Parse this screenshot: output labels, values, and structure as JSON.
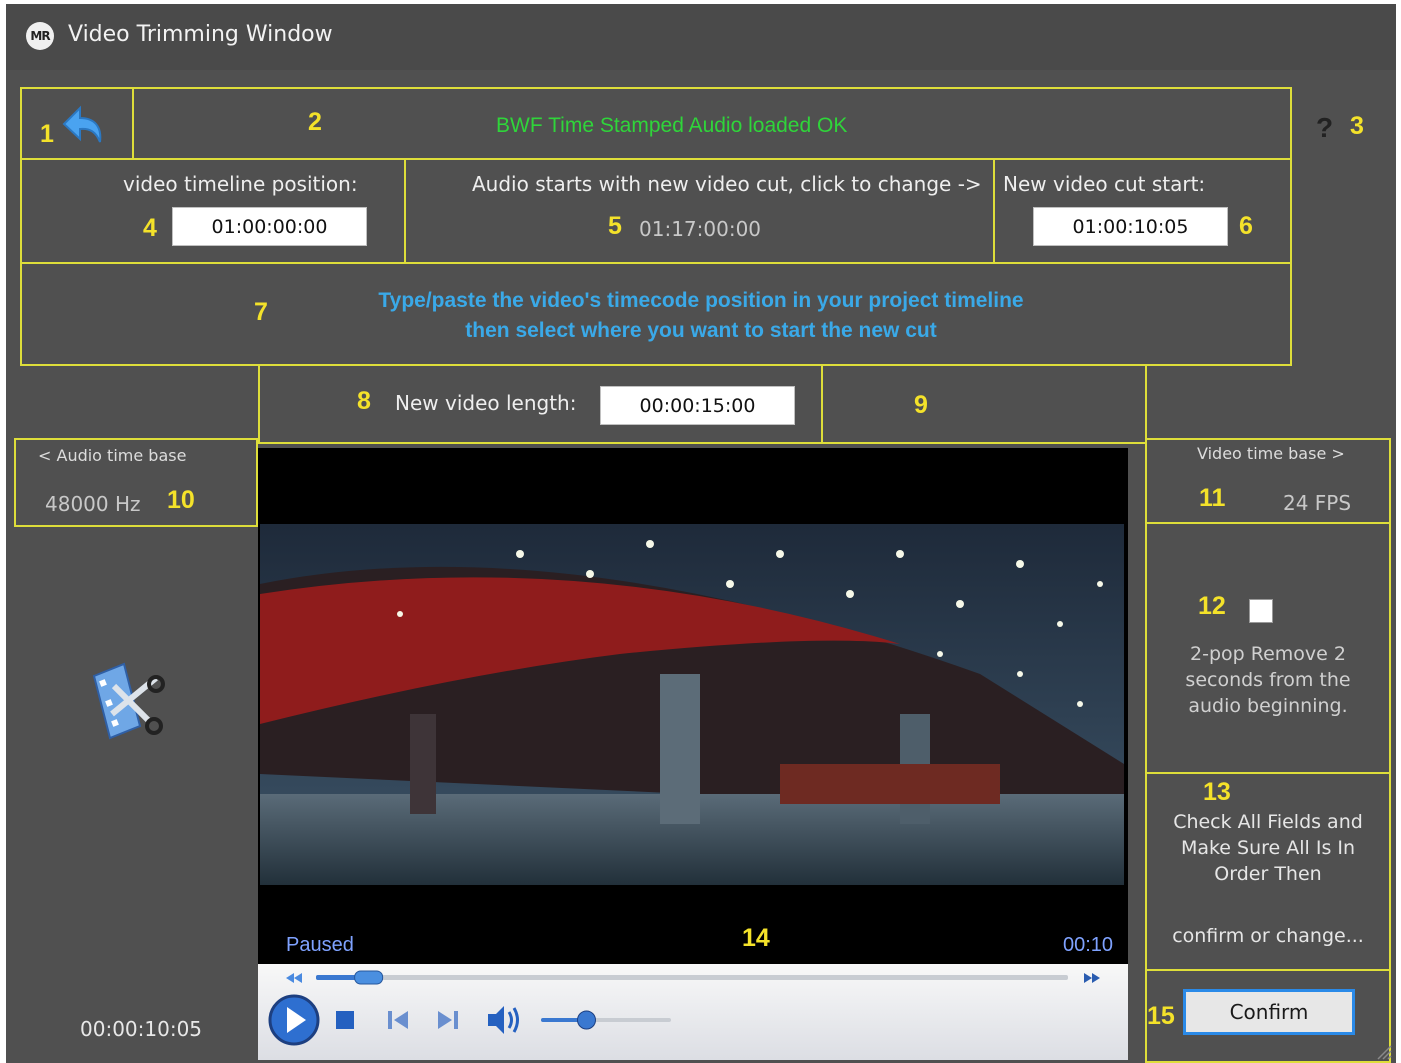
{
  "window": {
    "title": "Video Trimming Window",
    "logo_text": "MR"
  },
  "markers": {
    "m1": "1",
    "m2": "2",
    "m3": "3",
    "m4": "4",
    "m5": "5",
    "m6": "6",
    "m7": "7",
    "m8": "8",
    "m9": "9",
    "m10": "10",
    "m11": "11",
    "m12": "12",
    "m13": "13",
    "m14": "14",
    "m15": "15"
  },
  "status": {
    "message": "BWF Time Stamped Audio loaded OK",
    "help": "?"
  },
  "timeline": {
    "label": "video timeline position:",
    "value": "01:00:00:00"
  },
  "audio_start": {
    "label": "Audio starts with new video cut, click to change ->",
    "value": "01:17:00:00"
  },
  "cut_start": {
    "label": "New video cut start:",
    "value": "01:00:10:05"
  },
  "hint": {
    "line1": "Type/paste the video's timecode position in your project timeline",
    "line2": "then select where you want to start the new cut"
  },
  "length": {
    "label": "New video length:",
    "value": "00:00:15:00"
  },
  "audio_base": {
    "label": "< Audio time base",
    "value": "48000 Hz"
  },
  "video_base": {
    "label": "Video time base >",
    "value": "24 FPS"
  },
  "two_pop": {
    "text": "2-pop Remove 2 seconds from the audio beginning.",
    "checked": false
  },
  "check_fields": {
    "text": "Check All Fields and Make Sure All Is In Order Then",
    "confirm_hint": "confirm or change..."
  },
  "player": {
    "state": "Paused",
    "time": "00:10",
    "seek_fraction": 0.07,
    "volume_fraction": 0.35
  },
  "bottom_time": "00:00:10:05",
  "confirm_label": "Confirm",
  "colors": {
    "accent_yellow": "#f4e22a",
    "border_yellow": "#dede3a",
    "status_green": "#2fd53a",
    "hint_blue": "#3aa9e8"
  },
  "icons": [
    "undo-icon",
    "film-scissors-icon",
    "play-icon",
    "stop-icon",
    "previous-icon",
    "next-icon",
    "volume-icon",
    "rewind-icon",
    "fast-forward-icon"
  ]
}
